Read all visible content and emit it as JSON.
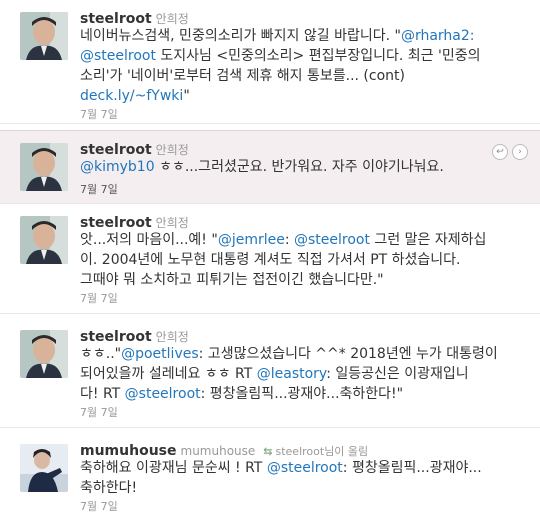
{
  "tweets": [
    {
      "username": "steelroot",
      "realname": "안희정",
      "lines": [
        [
          [
            "t",
            "네이버뉴스검색, 민중의소리가 빠지지 않길 바랍니다. \""
          ],
          [
            "a",
            "@rharha2:"
          ]
        ],
        [
          [
            "a",
            "@steelroot"
          ],
          [
            "t",
            " 도지사님 <민중의소리> 편집부장입니다. 최근 '민중의"
          ]
        ],
        [
          [
            "t",
            "소리'가 '네이버'로부터 검색 제휴 해지 통보를... (cont)"
          ]
        ],
        [
          [
            "a",
            "deck.ly/~fYwki"
          ],
          [
            "t",
            "\""
          ]
        ]
      ],
      "time": "7월 7일"
    },
    {
      "username": "steelroot",
      "realname": "안희정",
      "lines": [
        [
          [
            "a",
            "@kimyb10"
          ],
          [
            "t",
            " ㅎㅎ...그러셨군요. 반가워요. 자주 이야기나눠요."
          ]
        ]
      ],
      "time": "7월 7일",
      "highlight": true
    },
    {
      "username": "steelroot",
      "realname": "안희정",
      "lines": [
        [
          [
            "t",
            "앗...저의 마음이...예! \""
          ],
          [
            "a",
            "@jemrlee"
          ],
          [
            "t",
            ": "
          ],
          [
            "a",
            "@steelroot"
          ],
          [
            "t",
            " 그런 말은 자제하십"
          ]
        ],
        [
          [
            "t",
            "이. 2004년에 노무현 대통령 계셔도 직접 가셔서 PT 하셨습니다."
          ]
        ],
        [
          [
            "t",
            "그때야 뭐 소치하고 피튀기는 접전이긴 했습니다만.\""
          ]
        ]
      ],
      "time": "7월 7일"
    },
    {
      "username": "steelroot",
      "realname": "안희정",
      "lines": [
        [
          [
            "t",
            "ㅎㅎ..\""
          ],
          [
            "a",
            "@poetlives"
          ],
          [
            "t",
            ": 고생많으셨습니다 ^^* 2018년엔 누가 대통령이"
          ]
        ],
        [
          [
            "t",
            "되어있을까 설레네요 ㅎㅎ RT "
          ],
          [
            "a",
            "@leastory"
          ],
          [
            "t",
            ": 일등공신은 이광재입니"
          ]
        ],
        [
          [
            "t",
            "다! RT "
          ],
          [
            "a",
            "@steelroot"
          ],
          [
            "t",
            ": 평창올림픽...광재야...축하한다!\""
          ]
        ]
      ],
      "time": "7월 7일"
    },
    {
      "username": "mumuhouse",
      "realname": "mumuhouse",
      "retweeted_by": "steelroot님이 올림",
      "lines": [
        [
          [
            "t",
            "축하해요 이광재님 문순씨 ! RT "
          ],
          [
            "a",
            "@steelroot"
          ],
          [
            "t",
            ": 평창올림픽...광재야..."
          ]
        ],
        [
          [
            "t",
            "축하한다!"
          ]
        ]
      ],
      "time": "7월 7일"
    }
  ],
  "icons": {
    "retweet": "retweet-icon",
    "reply": "reply-icon",
    "more": "chevron-right-icon"
  },
  "colors": {
    "link": "#2276bb",
    "highlight_bg": "#f5eef1",
    "meta": "#999999"
  }
}
